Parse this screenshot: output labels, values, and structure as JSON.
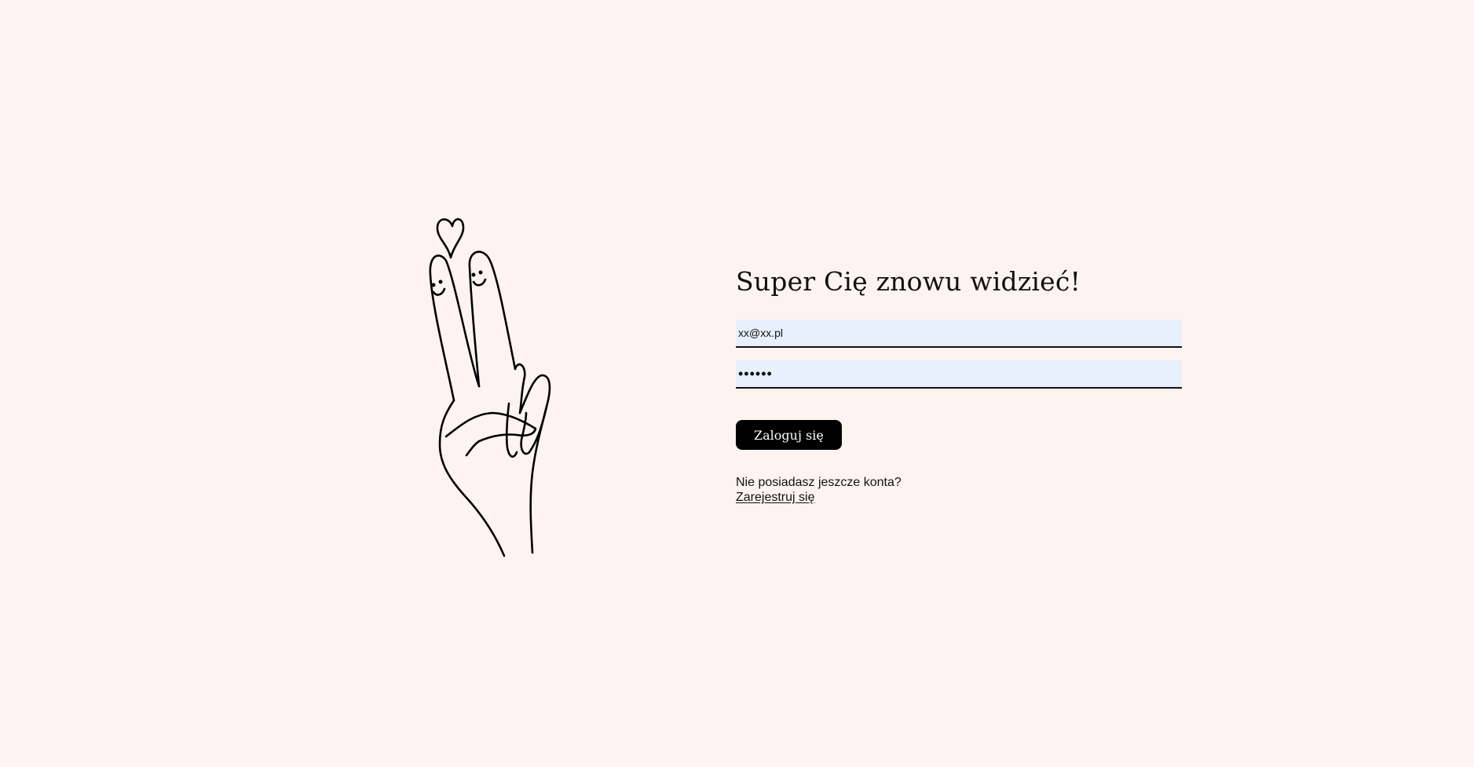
{
  "illustration": {
    "name": "peace-hand-illustration",
    "stroke_color": "#000000"
  },
  "login": {
    "title": "Super Cię znowu widzieć!",
    "email_value": "xx@xx.pl",
    "password_value": "••••••",
    "submit_label": "Zaloguj się",
    "register_question": "Nie posiadasz jeszcze konta?",
    "register_link": "Zarejestruj się"
  },
  "colors": {
    "background": "#fdf3f1",
    "input_background": "#e8f0fe",
    "button_background": "#000000",
    "button_text": "#ffffff",
    "text": "#111111"
  }
}
